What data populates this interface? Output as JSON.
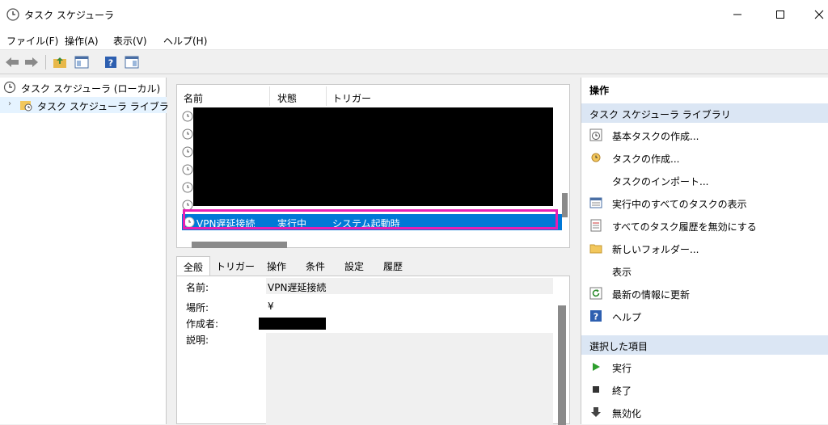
{
  "window": {
    "title": "タスク スケジューラ"
  },
  "menu": [
    "ファイル(F)",
    "操作(A)",
    "表示(V)",
    "ヘルプ(H)"
  ],
  "tree": {
    "root": "タスク スケジューラ (ローカル)",
    "library": "タスク スケジューラ ライブラリ"
  },
  "task_list": {
    "columns": [
      "名前",
      "状態",
      "トリガー"
    ],
    "selected": {
      "name": "VPN遅延接続",
      "status": "実行中",
      "trigger": "システム起動時"
    }
  },
  "tabs": [
    "全般",
    "トリガー",
    "操作",
    "条件",
    "設定",
    "履歴"
  ],
  "details": {
    "name_label": "名前:",
    "name_value": "VPN遅延接続",
    "location_label": "場所:",
    "location_value": "¥",
    "author_label": "作成者:",
    "description_label": "説明:"
  },
  "actions": {
    "header": "操作",
    "section1": "タスク スケジューラ ライブラリ",
    "items1": [
      "基本タスクの作成...",
      "タスクの作成...",
      "タスクのインポート...",
      "実行中のすべてのタスクの表示",
      "すべてのタスク履歴を無効にする",
      "新しいフォルダー...",
      "表示",
      "最新の情報に更新",
      "ヘルプ"
    ],
    "section2": "選択した項目",
    "items2": [
      "実行",
      "終了",
      "無効化"
    ]
  },
  "colors": {
    "selection": "#0078d7",
    "highlight_border": "#e81eb3",
    "section_bg": "#dbe6f4"
  }
}
